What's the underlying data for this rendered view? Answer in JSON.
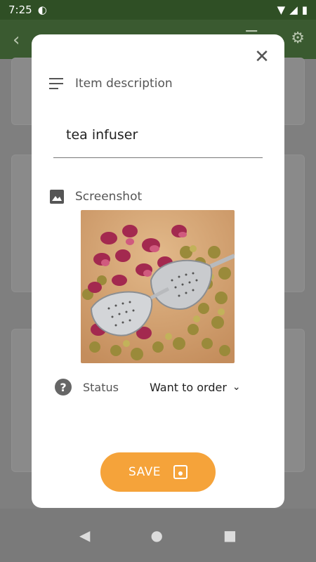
{
  "status_bar": {
    "time": "7:25"
  },
  "dialog": {
    "description_label": "Item description",
    "description_value": "tea infuser",
    "screenshot_label": "Screenshot",
    "status_label": "Status",
    "status_value": "Want to order",
    "save_label": "SAVE"
  },
  "icons": {
    "close": "close-icon",
    "description": "notes-icon",
    "screenshot": "image-icon",
    "status": "help-circle-icon",
    "save": "save-icon"
  },
  "colors": {
    "accent": "#f5a33a",
    "appbar": "#3a5a30",
    "statusbar": "#2f4f25"
  }
}
